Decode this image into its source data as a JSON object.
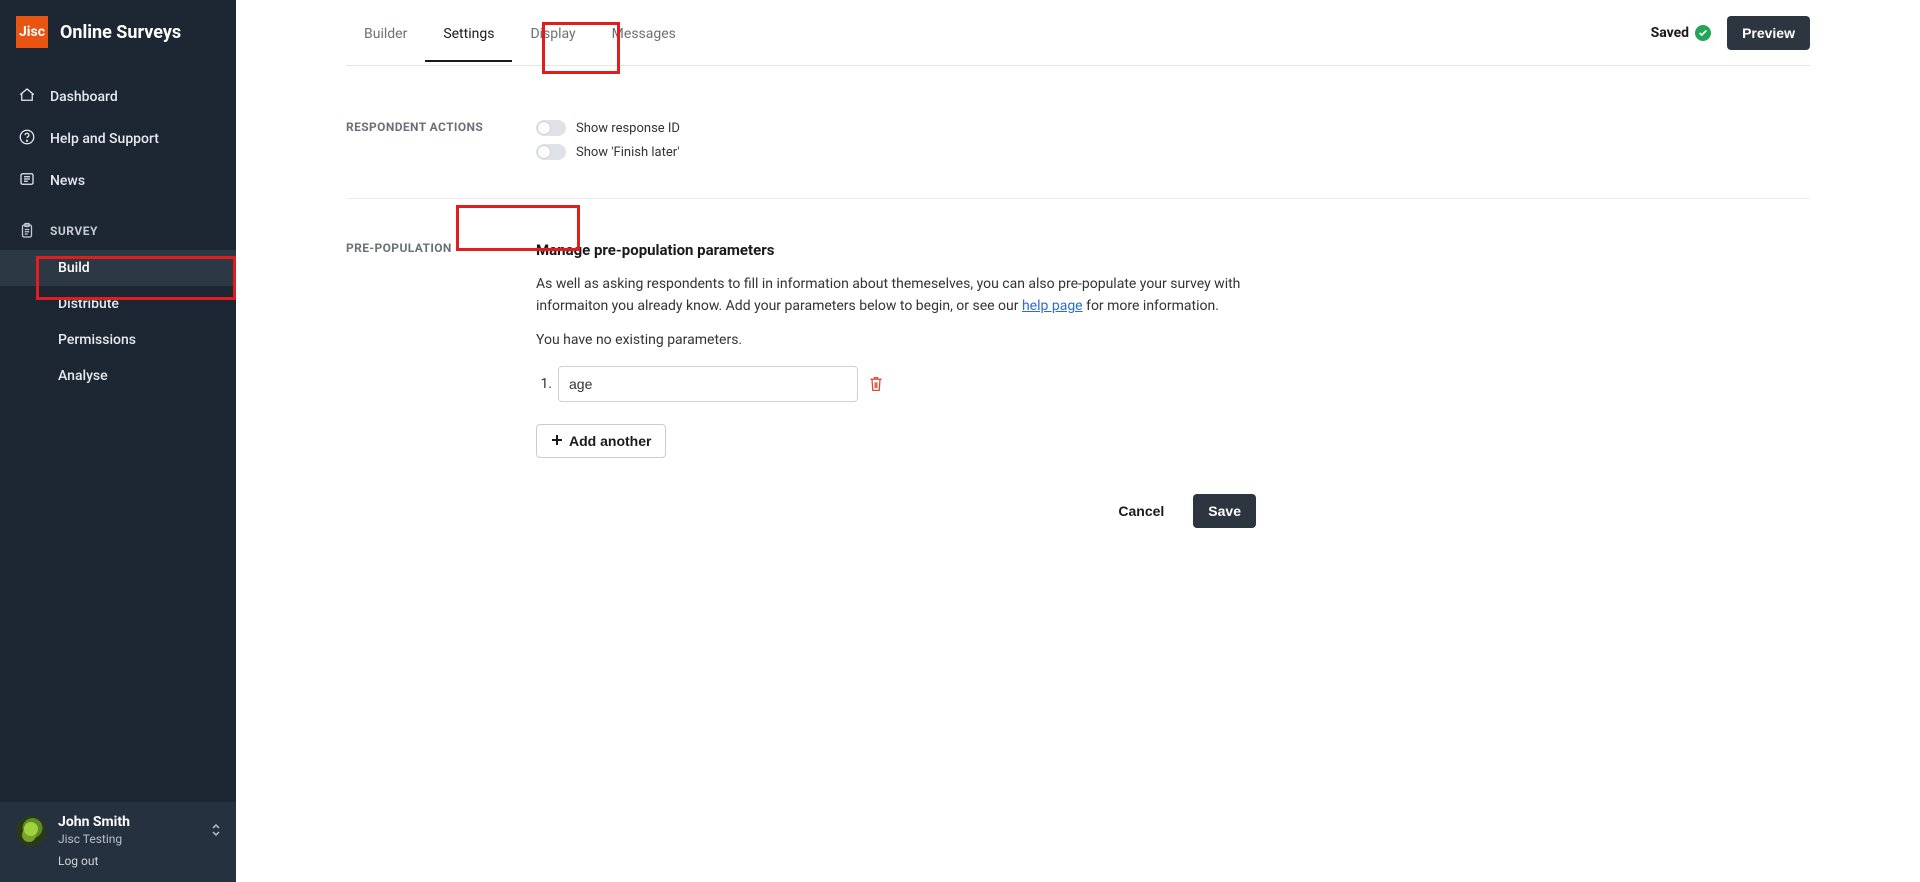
{
  "brand": {
    "logo": "Jisc",
    "title": "Online Surveys"
  },
  "sidebar": {
    "items": [
      {
        "label": "Dashboard"
      },
      {
        "label": "Help and Support"
      },
      {
        "label": "News"
      }
    ],
    "section": {
      "title": "SURVEY"
    },
    "subitems": [
      {
        "label": "Build"
      },
      {
        "label": "Distribute"
      },
      {
        "label": "Permissions"
      },
      {
        "label": "Analyse"
      }
    ],
    "user": {
      "name": "John Smith",
      "org": "Jisc Testing",
      "logout": "Log out"
    }
  },
  "tabs": {
    "items": [
      {
        "label": "Builder"
      },
      {
        "label": "Settings"
      },
      {
        "label": "Display"
      },
      {
        "label": "Messages"
      }
    ],
    "saved_label": "Saved",
    "preview_label": "Preview"
  },
  "settings": {
    "respondent_actions_label": "RESPONDENT ACTIONS",
    "toggles": {
      "show_response_id": "Show response ID",
      "show_finish_later": "Show 'Finish later'"
    },
    "prepop_label": "PRE-POPULATION",
    "prepop_heading": "Manage pre-population parameters",
    "prepop_text_1": "As well as asking respondents to fill in information about themeselves, you can also pre-populate your survey with informaiton you already know. Add your parameters below to begin, or see our ",
    "prepop_link": "help page",
    "prepop_text_2": " for more information.",
    "no_params": "You have no existing parameters.",
    "param_index": "1.",
    "param_value": "age",
    "add_another": "Add another",
    "cancel": "Cancel",
    "save": "Save"
  }
}
